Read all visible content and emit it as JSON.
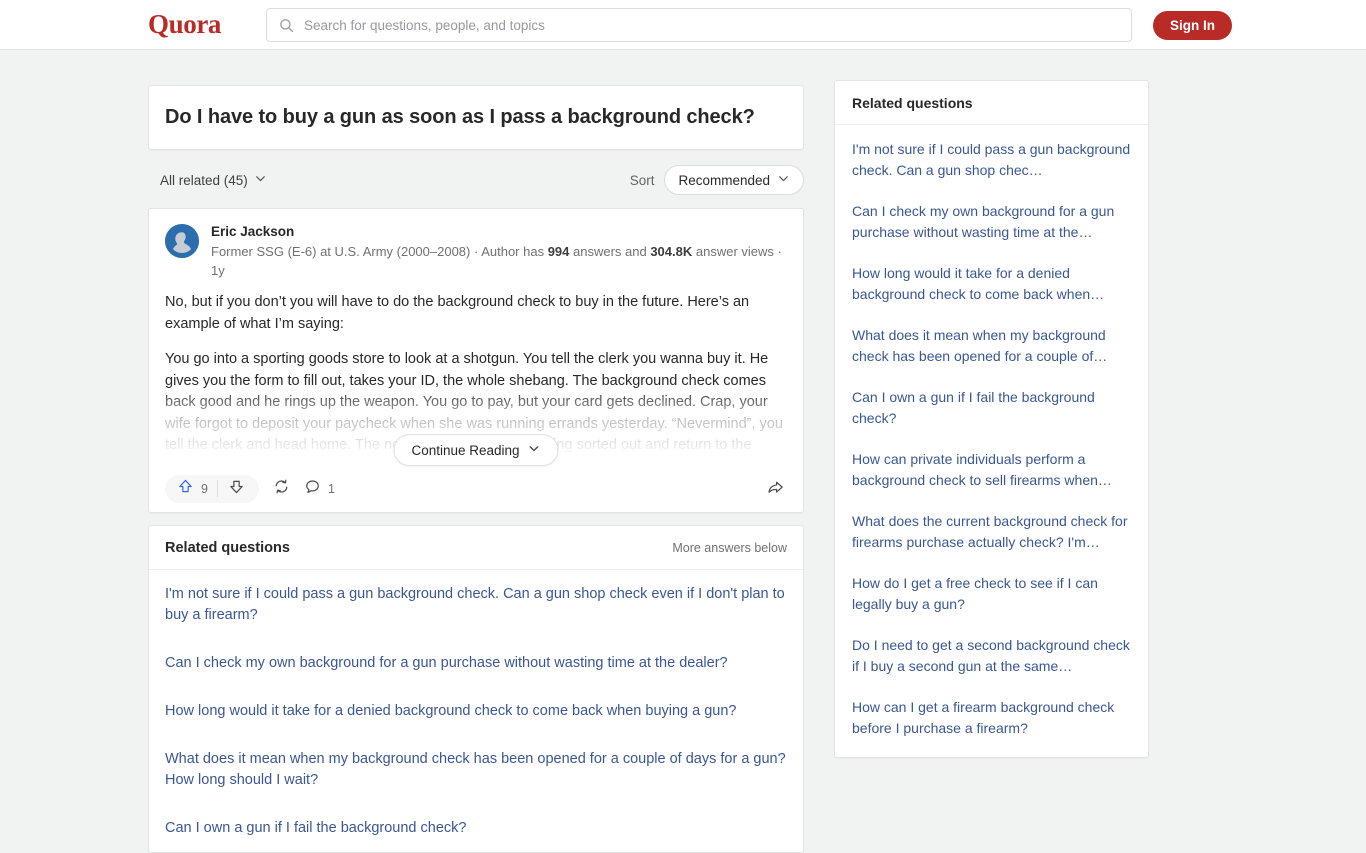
{
  "header": {
    "logo": "Quora",
    "search_placeholder": "Search for questions, people, and topics",
    "search_value": "",
    "signin_label": "Sign In",
    "brand_color": "#b92b27"
  },
  "question": {
    "title": "Do I have to buy a gun as soon as I pass a background check?"
  },
  "filters": {
    "all_related_label": "All related (45)",
    "sort_label": "Sort",
    "sort_value": "Recommended"
  },
  "answer": {
    "author": "Eric Jackson",
    "credential_prefix": "Former SSG (E-6) at U.S. Army (2000–2008) · Author has ",
    "answers_count": "994",
    "credential_mid": " answers and ",
    "views_count": "304.8K",
    "credential_suffix": " answer views · 1y",
    "paragraph_1": "No, but if you don’t you will have to do the background check to buy in the future. Here’s an example of what I’m saying:",
    "paragraph_2": "You go into a sporting goods store to look at a shotgun. You tell the clerk you wanna buy it. He gives you the form to fill out, takes your ID, the whole shebang. The background check comes back good and he rings up the weapon. You go to pay, but your card gets declined. Crap, your wife forgot to deposit your paycheck when she was running errands yesterday. “Nevermind”, you tell the clerk and head home. The next day you have everything sorted out and return to the store. You",
    "continue_label": "Continue Reading",
    "upvote_count": "9",
    "comment_count": "1"
  },
  "related_main": {
    "title": "Related questions",
    "more_label": "More answers below",
    "items": [
      "I'm not sure if I could pass a gun background check. Can a gun shop check even if I don't plan to buy a firearm?",
      "Can I check my own background for a gun purchase without wasting time at the dealer?",
      "How long would it take for a denied background check to come back when buying a gun?",
      "What does it mean when my background check has been opened for a couple of days for a gun? How long should I wait?",
      "Can I own a gun if I fail the background check?"
    ]
  },
  "related_sidebar": {
    "title": "Related questions",
    "items": [
      "I'm not sure if I could pass a gun background check. Can a gun shop chec…",
      "Can I check my own background for a gun purchase without wasting time at the…",
      "How long would it take for a denied background check to come back when…",
      "What does it mean when my background check has been opened for a couple of…",
      "Can I own a gun if I fail the background check?",
      "How can private individuals perform a background check to sell firearms when…",
      "What does the current background check for firearms purchase actually check? I'm…",
      "How do I get a free check to see if I can legally buy a gun?",
      "Do I need to get a second background check if I buy a second gun at the same…",
      "How can I get a firearm background check before I purchase a firearm?"
    ]
  }
}
